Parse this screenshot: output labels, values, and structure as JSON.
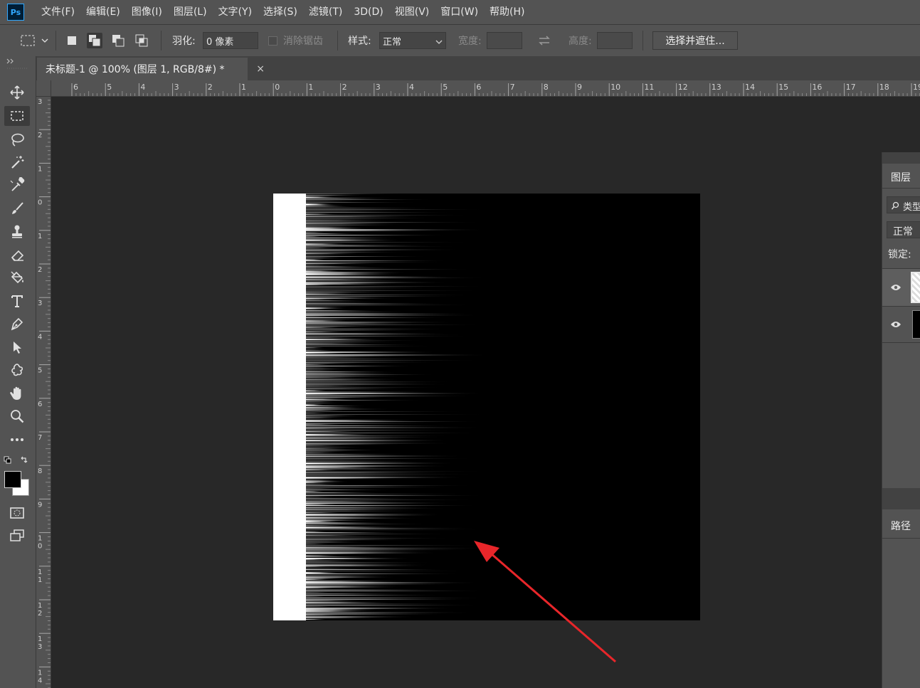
{
  "app": {
    "logo": "Ps",
    "accent": "#31a8ff"
  },
  "menu": [
    "文件(F)",
    "编辑(E)",
    "图像(I)",
    "图层(L)",
    "文字(Y)",
    "选择(S)",
    "滤镜(T)",
    "3D(D)",
    "视图(V)",
    "窗口(W)",
    "帮助(H)"
  ],
  "options": {
    "feather_label": "羽化:",
    "feather_value": "0 像素",
    "antialias_label": "消除锯齿",
    "style_label": "样式:",
    "style_value": "正常",
    "width_label": "宽度:",
    "height_label": "高度:",
    "select_mask_button": "选择并遮住..."
  },
  "document": {
    "tab_title": "未标题-1 @ 100% (图层 1, RGB/8#) *",
    "close_glyph": "×"
  },
  "rulers": {
    "horizontal": [
      "6",
      "5",
      "4",
      "3",
      "2",
      "1",
      "0",
      "1",
      "2",
      "3",
      "4",
      "5",
      "6",
      "7",
      "8",
      "9",
      "10",
      "11",
      "12",
      "13",
      "14",
      "15",
      "16",
      "17",
      "18",
      "19"
    ],
    "vertical": [
      "3",
      "2",
      "1",
      "0",
      "1",
      "2",
      "3",
      "4",
      "5",
      "6",
      "7",
      "8",
      "9",
      "10",
      "11",
      "12",
      "13",
      "14"
    ]
  },
  "tools": [
    "move-icon",
    "rect-marquee-icon",
    "lasso-icon",
    "magic-wand-icon",
    "eyedropper-icon",
    "brush-icon",
    "stamp-icon",
    "eraser-icon",
    "paint-bucket-icon",
    "type-icon",
    "pen-icon",
    "path-select-icon",
    "custom-shape-icon",
    "hand-icon",
    "zoom-icon",
    "more-icon"
  ],
  "colors": {
    "foreground": "#000000",
    "background": "#ffffff",
    "annotation_arrow": "#e8262a"
  },
  "layers_panel": {
    "title": "图层",
    "filter_label": "类型",
    "blend_mode": "正常",
    "lock_label": "锁定:"
  },
  "paths_panel": {
    "title": "路径"
  }
}
